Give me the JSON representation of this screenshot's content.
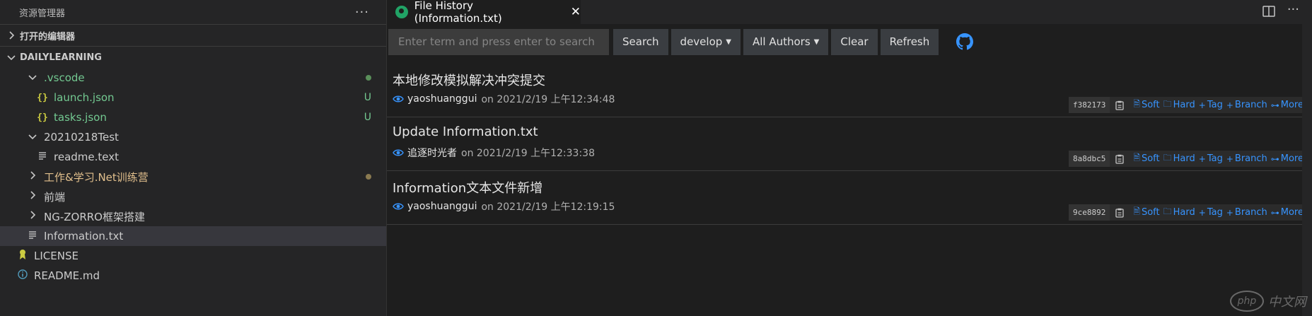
{
  "sidebar": {
    "title": "资源管理器",
    "more_icon": "ellipsis-icon",
    "open_editors_label": "打开的编辑器",
    "workspace_label": "DAILYLEARNING",
    "tree": [
      {
        "label": ".vscode",
        "type": "folder",
        "expanded": true,
        "indent": 1,
        "status": "dot",
        "status_color": "#5a8f5a",
        "color": "#73c991"
      },
      {
        "label": "launch.json",
        "type": "json",
        "indent": 2,
        "status": "U",
        "color": "#73c991"
      },
      {
        "label": "tasks.json",
        "type": "json",
        "indent": 2,
        "status": "U",
        "color": "#73c991"
      },
      {
        "label": "20210218Test",
        "type": "folder",
        "expanded": true,
        "indent": 1,
        "color": "#cccccc"
      },
      {
        "label": "readme.text",
        "type": "text",
        "indent": 2,
        "color": "#cccccc"
      },
      {
        "label": "工作&学习.Net训练营",
        "type": "folder",
        "expanded": false,
        "indent": 1,
        "status": "dot",
        "status_color": "#8a7a50",
        "color": "#e2c08d"
      },
      {
        "label": "前端",
        "type": "folder",
        "expanded": false,
        "indent": 1,
        "color": "#cccccc"
      },
      {
        "label": "NG-ZORRO框架搭建",
        "type": "folder",
        "expanded": false,
        "indent": 1,
        "color": "#cccccc"
      },
      {
        "label": "Information.txt",
        "type": "text",
        "indent": 1,
        "selected": true,
        "color": "#cccccc"
      },
      {
        "label": "LICENSE",
        "type": "license",
        "indent": 0,
        "color": "#cccccc"
      },
      {
        "label": "README.md",
        "type": "info",
        "indent": 0,
        "color": "#cccccc"
      }
    ]
  },
  "editor": {
    "tab_title": "File History (Information.txt)",
    "tab_close": "✕",
    "search_placeholder": "Enter term and press enter to search",
    "search_button": "Search",
    "branch_label": "develop",
    "authors_label": "All Authors",
    "clear_button": "Clear",
    "refresh_button": "Refresh",
    "commits": [
      {
        "message": "本地修改模拟解决冲突提交",
        "author": "yaoshuanggui",
        "date": "on 2021/2/19 上午12:34:48",
        "hash": "f382173"
      },
      {
        "message": "Update Information.txt",
        "author": "追逐时光者",
        "date": "on 2021/2/19 上午12:33:38",
        "hash": "8a8dbc5"
      },
      {
        "message": "Information文本文件新增",
        "author": "yaoshuanggui",
        "date": "on 2021/2/19 上午12:19:15",
        "hash": "9ce8892"
      }
    ],
    "actions": {
      "soft": "Soft",
      "hard": "Hard",
      "tag": "Tag",
      "branch": "Branch",
      "more": "More"
    }
  },
  "watermark": {
    "logo": "php",
    "text": "中文网"
  },
  "colors": {
    "accent": "#3794ff",
    "github": "#3794ff"
  }
}
